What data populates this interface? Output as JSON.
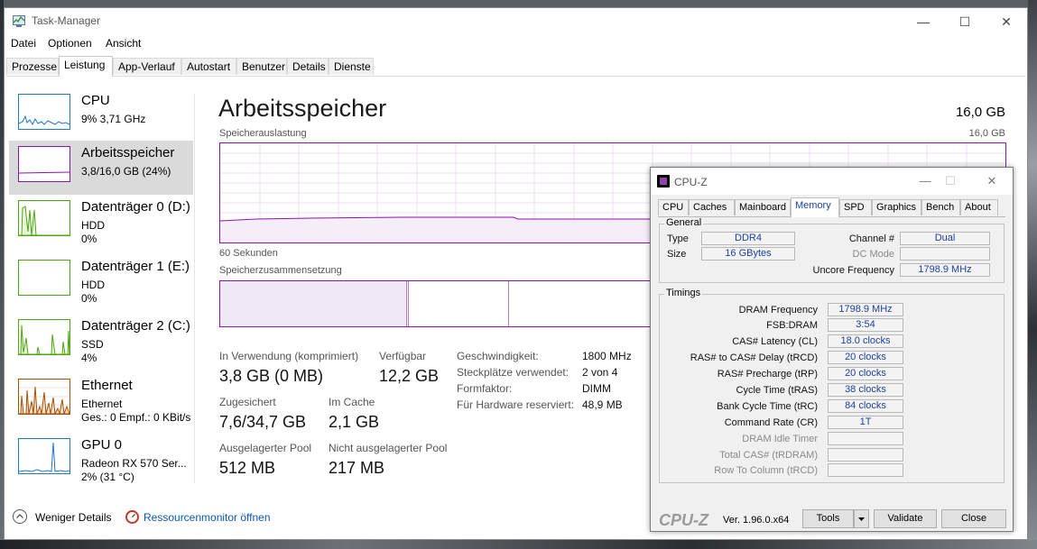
{
  "taskmanager": {
    "title": "Task-Manager",
    "menu": [
      "Datei",
      "Optionen",
      "Ansicht"
    ],
    "tabs": [
      "Prozesse",
      "Leistung",
      "App-Verlauf",
      "Autostart",
      "Benutzer",
      "Details",
      "Dienste"
    ],
    "active_tab": "Leistung",
    "sidebar": [
      {
        "name": "CPU",
        "line1": "9% 3,71 GHz",
        "line2": "",
        "color": "#1e78c8"
      },
      {
        "name": "Arbeitsspeicher",
        "line1": "3,8/16,0 GB (24%)",
        "line2": "",
        "color": "#8b12ae"
      },
      {
        "name": "Datenträger 0 (D:)",
        "line1": "HDD",
        "line2": "0%",
        "color": "#4da60c"
      },
      {
        "name": "Datenträger 1 (E:)",
        "line1": "HDD",
        "line2": "0%",
        "color": "#4da60c"
      },
      {
        "name": "Datenträger 2 (C:)",
        "line1": "SSD",
        "line2": "4%",
        "color": "#4da60c"
      },
      {
        "name": "Ethernet",
        "line1": "Ethernet",
        "line2": "Ges.: 0 Empf.: 0 KBit/s",
        "color": "#a74f01"
      },
      {
        "name": "GPU 0",
        "line1": "Radeon RX 570 Ser...",
        "line2": "2% (31 °C)",
        "color": "#1e78c8"
      }
    ],
    "main": {
      "title": "Arbeitsspeicher",
      "total": "16,0 GB",
      "usage_label": "Speicherauslastung",
      "usage_max": "16,0 GB",
      "time_label": "60 Sekunden",
      "composition_label": "Speicherzusammensetzung",
      "stats": {
        "inuse_label": "In Verwendung (komprimiert)",
        "inuse": "3,8 GB (0 MB)",
        "avail_label": "Verfügbar",
        "avail": "12,2 GB",
        "committed_label": "Zugesichert",
        "committed": "7,6/34,7 GB",
        "cached_label": "Im Cache",
        "cached": "2,1 GB",
        "paged_label": "Ausgelagerter Pool",
        "paged": "512 MB",
        "nonpaged_label": "Nicht ausgelagerter Pool",
        "nonpaged": "217 MB"
      },
      "info": [
        {
          "label": "Geschwindigkeit:",
          "value": "1800 MHz"
        },
        {
          "label": "Steckplätze verwendet:",
          "value": "2 von 4"
        },
        {
          "label": "Formfaktor:",
          "value": "DIMM"
        },
        {
          "label": "Für Hardware reserviert:",
          "value": "48,9 MB"
        }
      ]
    },
    "footer": {
      "less": "Weniger Details",
      "monitor": "Ressourcenmonitor öffnen"
    }
  },
  "cpuz": {
    "title": "CPU-Z",
    "tabs": [
      "CPU",
      "Caches",
      "Mainboard",
      "Memory",
      "SPD",
      "Graphics",
      "Bench",
      "About"
    ],
    "active_tab": "Memory",
    "general_label": "General",
    "type_label": "Type",
    "type": "DDR4",
    "size_label": "Size",
    "size": "16 GBytes",
    "channel_label": "Channel #",
    "channel": "Dual",
    "dcmode_label": "DC Mode",
    "dcmode": "",
    "uncore_label": "Uncore Frequency",
    "uncore": "1798.9 MHz",
    "timings_label": "Timings",
    "timings": [
      {
        "label": "DRAM Frequency",
        "value": "1798.9 MHz",
        "dim": false
      },
      {
        "label": "FSB:DRAM",
        "value": "3:54",
        "dim": false
      },
      {
        "label": "CAS# Latency (CL)",
        "value": "18.0 clocks",
        "dim": false
      },
      {
        "label": "RAS# to CAS# Delay (tRCD)",
        "value": "20 clocks",
        "dim": false
      },
      {
        "label": "RAS# Precharge (tRP)",
        "value": "20 clocks",
        "dim": false
      },
      {
        "label": "Cycle Time (tRAS)",
        "value": "38 clocks",
        "dim": false
      },
      {
        "label": "Bank Cycle Time (tRC)",
        "value": "84 clocks",
        "dim": false
      },
      {
        "label": "Command Rate (CR)",
        "value": "1T",
        "dim": false
      },
      {
        "label": "DRAM Idle Timer",
        "value": "",
        "dim": true
      },
      {
        "label": "Total CAS# (tRDRAM)",
        "value": "",
        "dim": true
      },
      {
        "label": "Row To Column (tRCD)",
        "value": "",
        "dim": true
      }
    ],
    "brand": "CPU-Z",
    "version": "Ver. 1.96.0.x64",
    "tools": "Tools",
    "validate": "Validate",
    "close": "Close"
  }
}
